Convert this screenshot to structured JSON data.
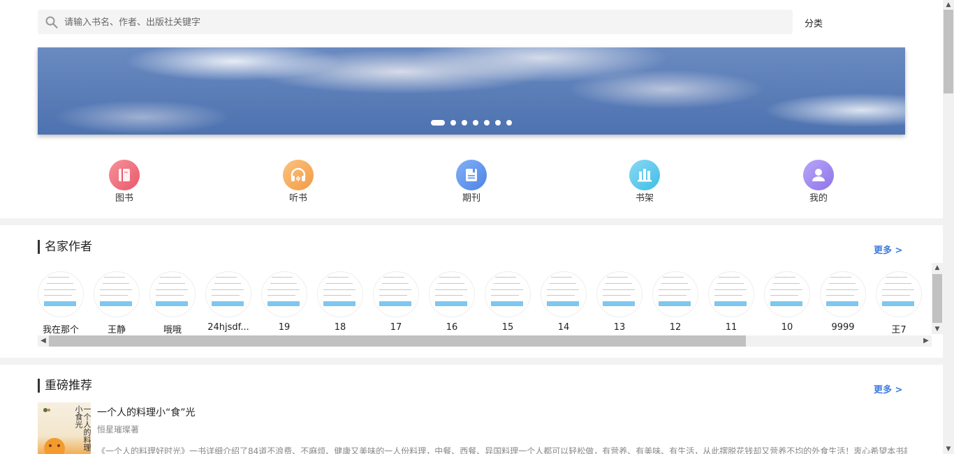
{
  "search": {
    "placeholder": "请输入书名、作者、出版社关键字"
  },
  "header": {
    "category_label": "分类"
  },
  "banner": {
    "dot_count": 7,
    "active_dot": 0
  },
  "nav": [
    {
      "label": "图书",
      "icon": "book-icon",
      "color": "#ef6f76"
    },
    {
      "label": "听书",
      "icon": "headphones-icon",
      "color": "#f7a35c"
    },
    {
      "label": "期刊",
      "icon": "journal-icon",
      "color": "#5f93ec"
    },
    {
      "label": "书架",
      "icon": "bookshelf-icon",
      "color": "#4cc3e8"
    },
    {
      "label": "我的",
      "icon": "user-icon",
      "color": "#9b84ef"
    }
  ],
  "authors_section": {
    "title": "名家作者",
    "more": "更多 >",
    "authors": [
      "我在那个",
      "王静",
      "哦哦",
      "24hjsdf...",
      "19",
      "18",
      "17",
      "16",
      "15",
      "14",
      "13",
      "12",
      "11",
      "10",
      "9999",
      "王7"
    ]
  },
  "recommend_section": {
    "title": "重磅推荐",
    "more": "更多 >",
    "book": {
      "title": "一个人的料理小“食”光",
      "author": "恒星璀璨著",
      "description": "《一个人的料理好时光》一书详细介绍了84道不浪费、不麻烦、健康又美味的一人份料理，中餐、西餐、异国料理一个人都可以轻松做，有营养、有美味、有生活，从此摆脱花钱却又营养不均的外食生活！衷心希望本书能让所有必须一",
      "cover_text": "一个人的料理小食光"
    }
  }
}
